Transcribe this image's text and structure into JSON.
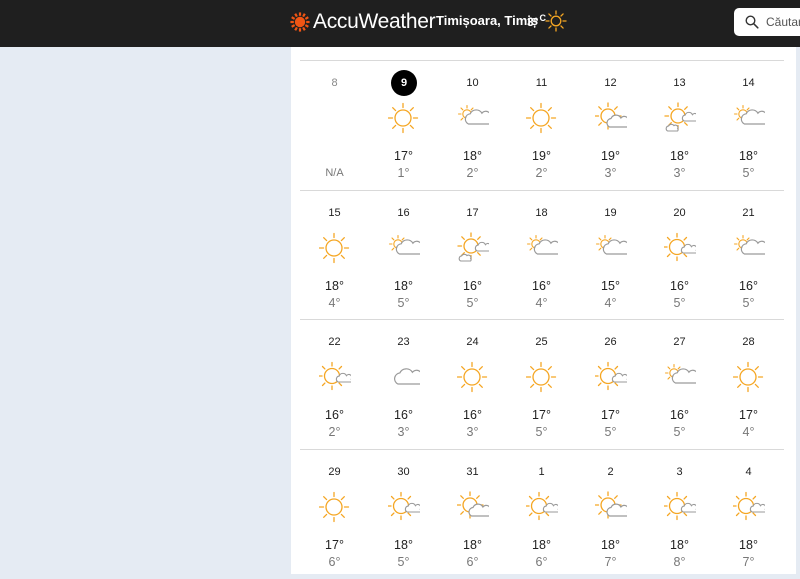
{
  "header": {
    "logo_text": "AccuWeather",
    "location": "Timișoara, Timiș",
    "current_temp": "3°",
    "current_unit": "C",
    "search_placeholder": "Căutare"
  },
  "weeks": [
    [
      {
        "day": "8",
        "past": true,
        "icon": "none",
        "high": "",
        "low": "N/A"
      },
      {
        "day": "9",
        "today": true,
        "icon": "sun",
        "high": "17°",
        "low": "1°"
      },
      {
        "day": "10",
        "icon": "cloud-sun-small",
        "high": "18°",
        "low": "2°"
      },
      {
        "day": "11",
        "icon": "sun",
        "high": "19°",
        "low": "2°"
      },
      {
        "day": "12",
        "icon": "sun-cloud",
        "high": "19°",
        "low": "3°"
      },
      {
        "day": "13",
        "icon": "sun-clouds",
        "high": "18°",
        "low": "3°"
      },
      {
        "day": "14",
        "icon": "cloud-sun-small",
        "high": "18°",
        "low": "5°"
      }
    ],
    [
      {
        "day": "15",
        "icon": "sun",
        "high": "18°",
        "low": "4°"
      },
      {
        "day": "16",
        "icon": "cloud-sun-small",
        "high": "18°",
        "low": "5°"
      },
      {
        "day": "17",
        "icon": "sun-clouds",
        "high": "16°",
        "low": "5°"
      },
      {
        "day": "18",
        "icon": "cloud-sun-small",
        "high": "16°",
        "low": "4°"
      },
      {
        "day": "19",
        "icon": "cloud-sun-small",
        "high": "15°",
        "low": "4°"
      },
      {
        "day": "20",
        "icon": "sun-cloud-small",
        "high": "16°",
        "low": "5°"
      },
      {
        "day": "21",
        "icon": "cloud-sun-small",
        "high": "16°",
        "low": "5°"
      }
    ],
    [
      {
        "day": "22",
        "icon": "sun-cloud-small",
        "high": "16°",
        "low": "2°"
      },
      {
        "day": "23",
        "icon": "cloud",
        "high": "16°",
        "low": "3°"
      },
      {
        "day": "24",
        "icon": "sun",
        "high": "16°",
        "low": "3°"
      },
      {
        "day": "25",
        "icon": "sun",
        "high": "17°",
        "low": "5°"
      },
      {
        "day": "26",
        "icon": "sun-cloud-small",
        "high": "17°",
        "low": "5°"
      },
      {
        "day": "27",
        "icon": "cloud-sun-small",
        "high": "16°",
        "low": "5°"
      },
      {
        "day": "28",
        "icon": "sun",
        "high": "17°",
        "low": "4°"
      }
    ],
    [
      {
        "day": "29",
        "icon": "sun",
        "high": "17°",
        "low": "6°"
      },
      {
        "day": "30",
        "icon": "sun-cloud-small",
        "high": "18°",
        "low": "5°"
      },
      {
        "day": "31",
        "icon": "sun-cloud",
        "high": "18°",
        "low": "6°"
      },
      {
        "day": "1",
        "icon": "sun-cloud-small",
        "high": "18°",
        "low": "6°"
      },
      {
        "day": "2",
        "icon": "sun-cloud",
        "high": "18°",
        "low": "7°"
      },
      {
        "day": "3",
        "icon": "sun-cloud-small",
        "high": "18°",
        "low": "8°"
      },
      {
        "day": "4",
        "icon": "sun-cloud-small",
        "high": "18°",
        "low": "7°"
      }
    ]
  ],
  "colors": {
    "sun": "#f5a623",
    "cloud": "#9a9a9a",
    "header_bg": "#1f1f1f",
    "page_bg": "#e5ebf3",
    "logo_orange": "#f05514"
  }
}
